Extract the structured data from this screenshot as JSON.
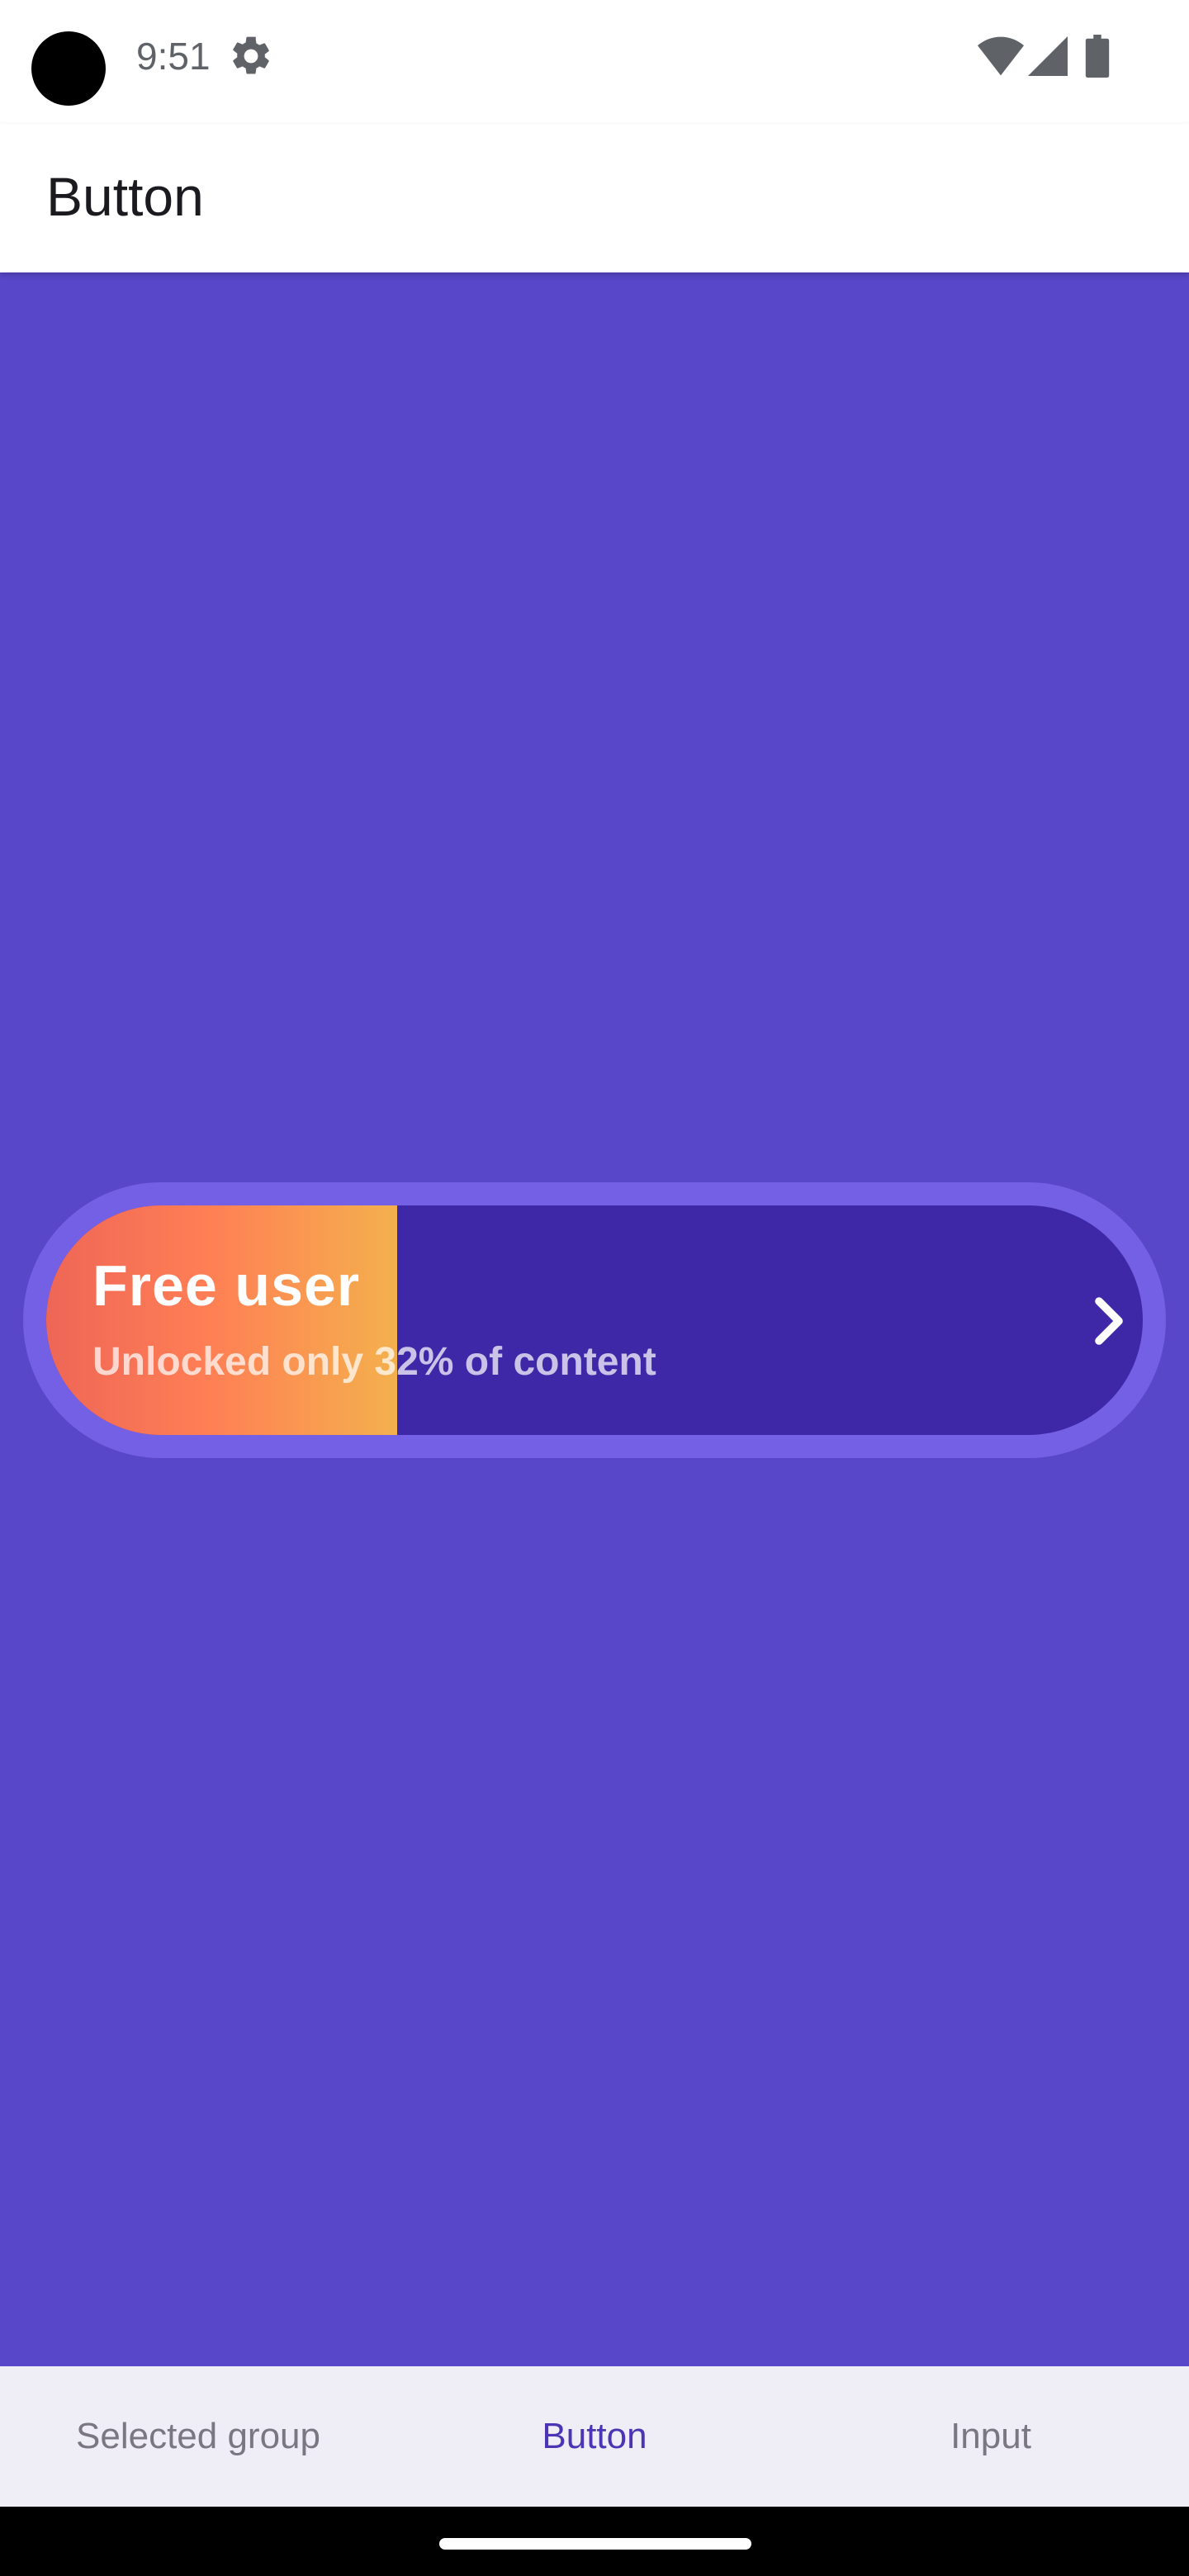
{
  "status_bar": {
    "time": "9:51",
    "icons": [
      "settings-icon",
      "wifi-icon",
      "signal-icon",
      "battery-icon"
    ]
  },
  "app_bar": {
    "title": "Button"
  },
  "upgrade_button": {
    "title": "Free user",
    "subtitle": "Unlocked only 32% of content",
    "progress_fraction": 0.32,
    "icon": "chevron-right-icon",
    "colors": {
      "track": "#3F28A8",
      "outer_ring": "#7460E4",
      "fill_start": "#EE6656",
      "fill_mid": "#FF7E55",
      "fill_end": "#F4B04D"
    }
  },
  "bottom_nav": {
    "items": [
      {
        "label": "Selected group",
        "active": false
      },
      {
        "label": "Button",
        "active": true
      },
      {
        "label": "Input",
        "active": false
      }
    ],
    "active_color": "#4B35B5"
  },
  "colors": {
    "background": "#5847C8"
  }
}
